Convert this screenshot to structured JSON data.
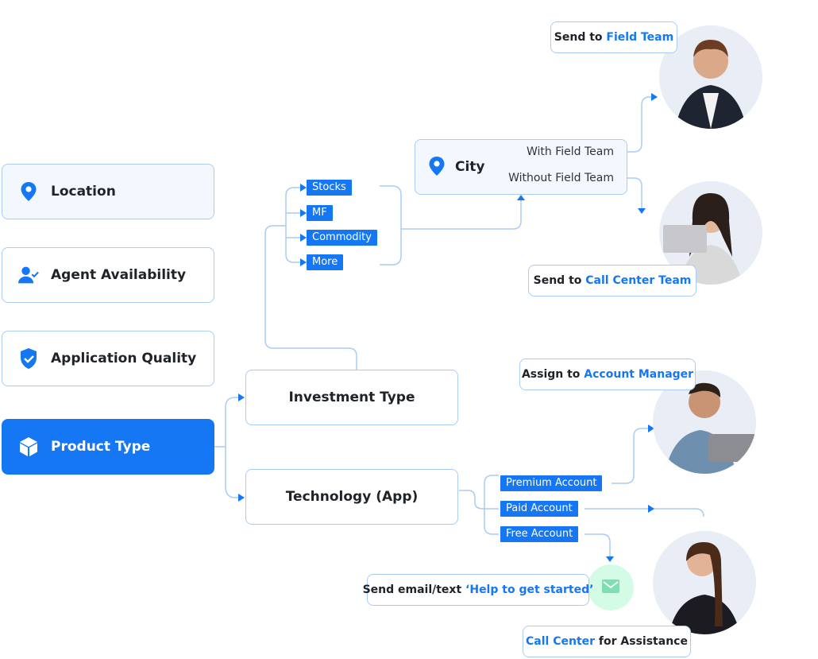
{
  "criteria": [
    {
      "label": "Location",
      "icon": "map-pin-icon"
    },
    {
      "label": "Agent Availability",
      "icon": "user-check-icon"
    },
    {
      "label": "Application Quality",
      "icon": "shield-check-icon"
    },
    {
      "label": "Product Type",
      "icon": "box-icon",
      "active": true
    }
  ],
  "product_branches": {
    "investment": "Investment Type",
    "technology": "Technology (App)"
  },
  "investment_tags": [
    "Stocks",
    "MF",
    "Commodity",
    "More"
  ],
  "city": {
    "title": "City",
    "options": [
      "With Field Team",
      "Without Field Team"
    ]
  },
  "account_tags": [
    "Premium Account",
    "Paid Account",
    "Free Account"
  ],
  "callouts": {
    "field_team": {
      "prefix": "Send to ",
      "highlight": "Field Team"
    },
    "call_center_team": {
      "prefix": "Send to ",
      "highlight": "Call Center Team"
    },
    "account_manager": {
      "prefix": "Assign to ",
      "highlight": "Account Manager"
    },
    "email": {
      "prefix": "Send email/text ",
      "highlight": "‘Help to get started’"
    },
    "assistance": {
      "highlight": "Call Center",
      "suffix": " for Assistance"
    }
  },
  "colors": {
    "accent": "#1677f5",
    "line": "#a9ccf5",
    "light_bg": "#f3f8ff",
    "mail_bg": "#d3fbe6",
    "mail_icon": "#7ee0b1"
  }
}
